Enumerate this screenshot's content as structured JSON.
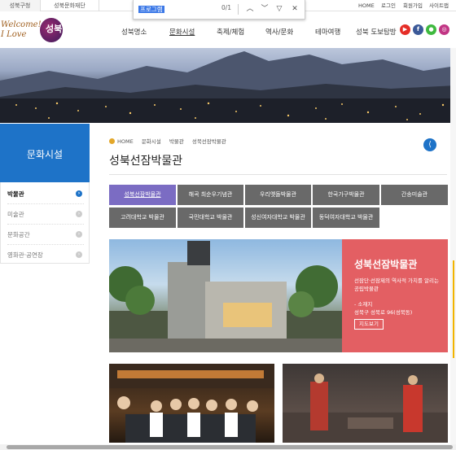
{
  "topbar": {
    "tabs": [
      "성북구청",
      "성북문화재단"
    ],
    "util_links": [
      "HOME",
      "로그인",
      "회원가입",
      "사이트맵"
    ]
  },
  "find": {
    "query": "프로그램",
    "count": "0/1",
    "icons": [
      "chevron-up-icon",
      "chevron-down-icon",
      "filter-icon",
      "close-icon"
    ]
  },
  "logo": {
    "line1": "Welcome!",
    "line2": "I Love",
    "mark": "성북"
  },
  "nav": {
    "items": [
      "성북명소",
      "문화시설",
      "축제/체험",
      "역사/문화",
      "테마여행",
      "성북 도보탐방"
    ],
    "active_index": 1
  },
  "sns": [
    {
      "name": "youtube-icon",
      "color": "#e52d27",
      "glyph": "▶"
    },
    {
      "name": "facebook-icon",
      "color": "#3b5998",
      "glyph": "f"
    },
    {
      "name": "line-icon",
      "color": "#3fb93f",
      "glyph": "●"
    },
    {
      "name": "instagram-icon",
      "color": "#c13584",
      "glyph": "◎"
    }
  ],
  "sidebar": {
    "title": "문화시설",
    "items": [
      {
        "label": "박물관",
        "active": true
      },
      {
        "label": "미술관",
        "active": false
      },
      {
        "label": "문화공간",
        "active": false
      },
      {
        "label": "영화관·공연장",
        "active": false
      }
    ]
  },
  "breadcrumb": [
    "HOME",
    "문화시설",
    "박물관",
    "성북선잠박물관"
  ],
  "page_title": "성북선잠박물관",
  "museums": [
    {
      "label": "성북선잠박물관",
      "active": true
    },
    {
      "label": "해곡 최순우기념관",
      "active": false
    },
    {
      "label": "우리옛돌박물관",
      "active": false
    },
    {
      "label": "한국가구박물관",
      "active": false
    },
    {
      "label": "간송미술관",
      "active": false
    },
    {
      "label": "고려대학교 박물관",
      "active": false
    },
    {
      "label": "국민대학교 박물관",
      "active": false
    },
    {
      "label": "성신여자대학교 박물관",
      "active": false
    },
    {
      "label": "동덕여자대학교 박물관",
      "active": false
    }
  ],
  "feature": {
    "title": "성북선잠박물관",
    "desc": "선잠단·선잠제의 역사적 가치를 알리는 공립박물관",
    "addr_label": "- 소재지",
    "addr": "성북구 성북로 96(성북동)",
    "map_button": "지도보기"
  }
}
